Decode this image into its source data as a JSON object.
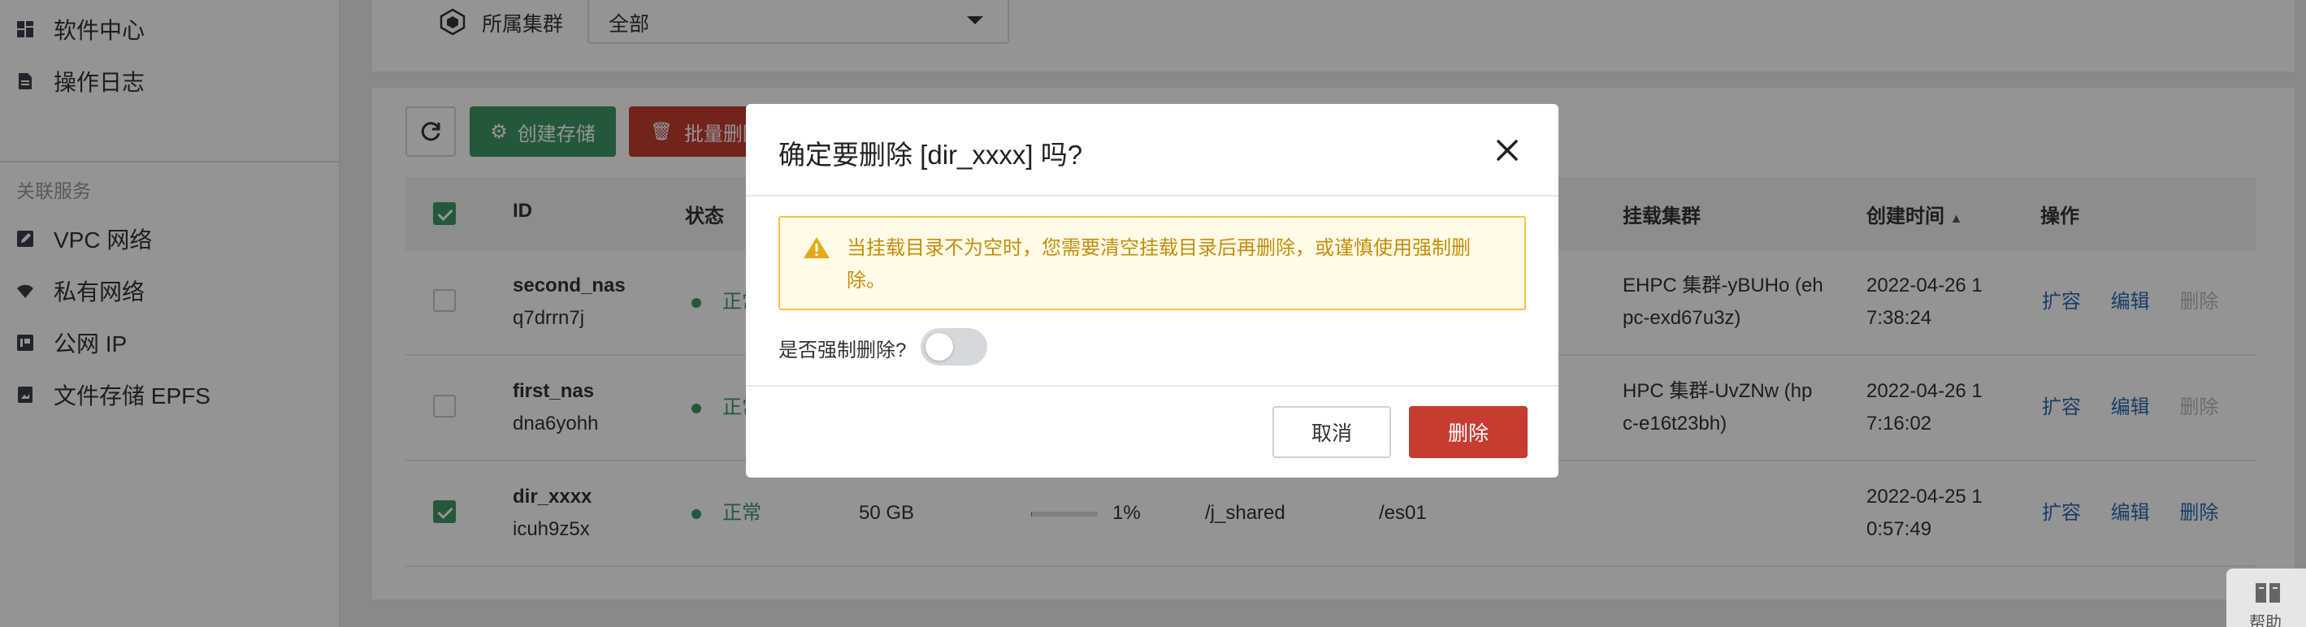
{
  "sidebar": {
    "items_top": [
      {
        "label": "软件中心",
        "icon": "grid-icon"
      },
      {
        "label": "操作日志",
        "icon": "document-icon"
      }
    ],
    "section_title": "关联服务",
    "items_bottom": [
      {
        "label": "VPC 网络",
        "icon": "pencil-square-icon"
      },
      {
        "label": "私有网络",
        "icon": "wifi-icon"
      },
      {
        "label": "公网 IP",
        "icon": "ip-icon"
      },
      {
        "label": "文件存储 EPFS",
        "icon": "file-storage-icon"
      }
    ]
  },
  "filter": {
    "label": "所属集群",
    "value": "全部",
    "icon": "cube-icon"
  },
  "toolbar": {
    "create_label": "创建存储",
    "batch_delete_label": "批量删除"
  },
  "table": {
    "headers": {
      "id": "ID",
      "status": "状态",
      "cluster": "挂载集群",
      "created": "创建时间",
      "actions": "操作"
    },
    "rows": [
      {
        "name": "second_nas",
        "id": "q7drrn7j",
        "status": "正常",
        "cluster_line1": "EHPC 集群-yBUHo (eh",
        "cluster_line2": "pc-exd67u3z)",
        "created_line1": "2022-04-26 1",
        "created_line2": "7:38:24",
        "action_expand": "扩容",
        "action_edit": "编辑",
        "action_delete": "删除",
        "checked": false
      },
      {
        "name": "first_nas",
        "id": "dna6yohh",
        "status": "正常",
        "cluster_line1": "HPC 集群-UvZNw (hp",
        "cluster_line2": "c-e16t23bh)",
        "created_line1": "2022-04-26 1",
        "created_line2": "7:16:02",
        "action_expand": "扩容",
        "action_edit": "编辑",
        "action_delete": "删除",
        "checked": false
      },
      {
        "name": "dir_xxxx",
        "id": "icuh9z5x",
        "status": "正常",
        "size": "50 GB",
        "usage": "1%",
        "usage_fraction": 0.01,
        "path": "/j_shared",
        "mount": "/es01",
        "created_line1": "2022-04-25 1",
        "created_line2": "0:57:49",
        "action_expand": "扩容",
        "action_edit": "编辑",
        "action_delete": "删除",
        "checked": true
      }
    ]
  },
  "dialog": {
    "title": "确定要删除 [dir_xxxx] 吗?",
    "warning": "当挂载目录不为空时，您需要清空挂载目录后再删除，或谨慎使用强制删除。",
    "force_label": "是否强制删除?",
    "force_enabled": false,
    "cancel_label": "取消",
    "delete_label": "删除"
  },
  "help": {
    "label": "帮助"
  },
  "colors": {
    "primary_green": "#3f9866",
    "danger_red": "#c73b31",
    "link_blue": "#2b6cb0",
    "warning_text": "#c38e0a"
  }
}
